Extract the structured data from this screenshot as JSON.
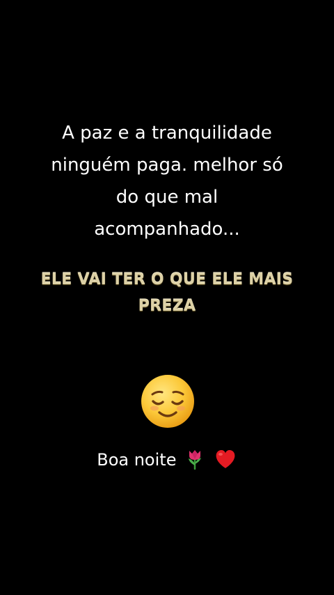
{
  "background_color": "#000000",
  "message": {
    "lines": [
      "A paz e a tranquilidade",
      "ninguém paga. melhor só",
      "do que mal",
      "acompanhado..."
    ]
  },
  "caption": {
    "lines": [
      "ELE VAI TER O QUE ELE MAIS",
      "PREZA"
    ],
    "color": "#ddd1a6"
  },
  "emoji": {
    "icon": "relieved-face-icon"
  },
  "greeting": {
    "text": "Boa noite",
    "icons": [
      "tulip-icon",
      "red-heart-icon"
    ]
  }
}
